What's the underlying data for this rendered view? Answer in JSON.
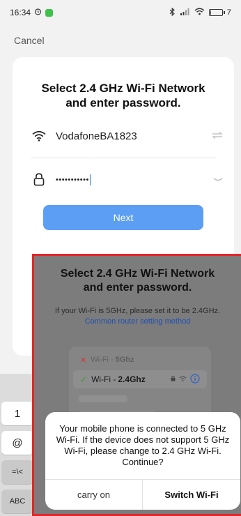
{
  "status_bar": {
    "time": "16:34",
    "battery": "7",
    "battery_level": 0.07
  },
  "header": {
    "cancel_label": "Cancel"
  },
  "form": {
    "title_line1": "Select 2.4 GHz Wi-Fi Network",
    "title_line2": "and enter password.",
    "ssid_value": "VodafoneBA1823",
    "password_mask": "•••••••••••",
    "next_label": "Next"
  },
  "keyboard": {
    "keys": [
      "1",
      "@",
      "=\\<",
      "ABC"
    ]
  },
  "overlay": {
    "title_line1": "Select 2.4 GHz Wi-Fi Network",
    "title_line2": "and enter password.",
    "subtitle": "If your Wi-Fi is 5GHz, please set it to be 2.4GHz.",
    "link": "Common router setting method",
    "wifi_5g_prefix": "Wi-Fi - ",
    "wifi_5g_band": "5Ghz",
    "wifi_24_prefix": "Wi-Fi - ",
    "wifi_24_band": "2.4Ghz"
  },
  "dialog": {
    "message": "Your mobile phone is connected to 5 GHz Wi-Fi. If the device does not support 5 GHz Wi-Fi, please change to 2.4 GHz Wi-Fi. Continue?",
    "left_button": "carry on",
    "right_button": "Switch Wi-Fi"
  },
  "colors": {
    "accent": "#5b9ef4",
    "highlight_border": "#e2262b",
    "error_mark": "#d9322b",
    "ok_mark": "#3a9b3a"
  }
}
